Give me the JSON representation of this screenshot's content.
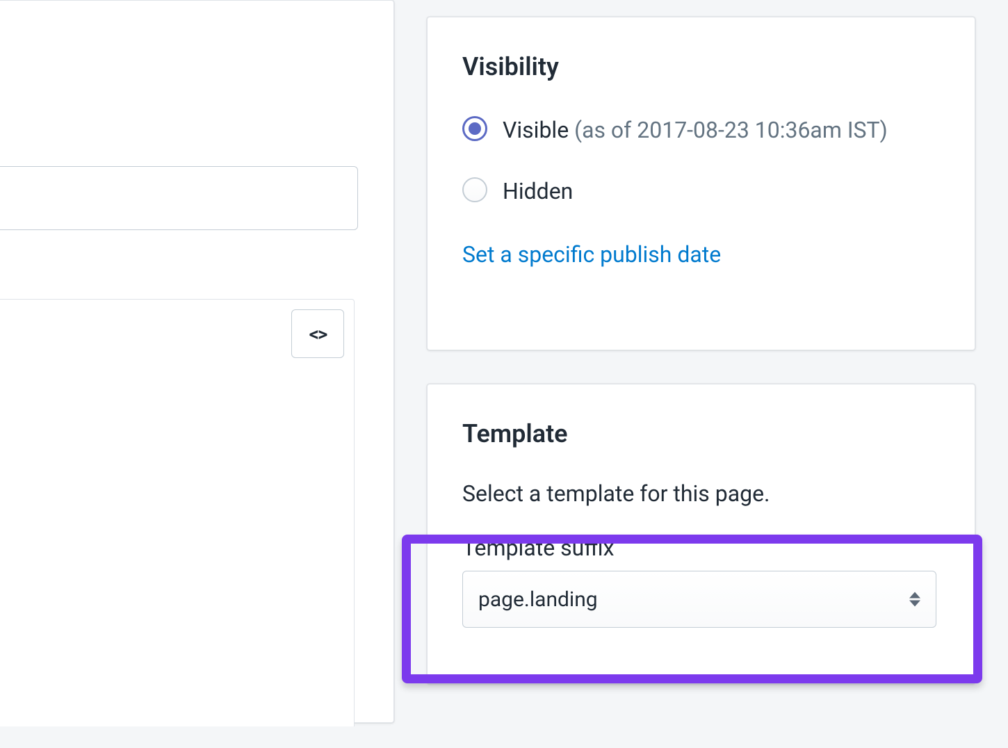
{
  "visibility": {
    "title": "Visibility",
    "options": {
      "visible_label": "Visible",
      "visible_note": "(as of 2017-08-23 10:36am IST)",
      "hidden_label": "Hidden"
    },
    "publish_link": "Set a specific publish date"
  },
  "template": {
    "title": "Template",
    "description": "Select a template for this page.",
    "suffix_label": "Template suffix",
    "suffix_value": "page.landing"
  },
  "toolbar": {
    "code_button_glyph": "<>"
  },
  "colors": {
    "accent": "#5c6ac4",
    "link": "#007ace",
    "highlight": "#7c3aed"
  }
}
